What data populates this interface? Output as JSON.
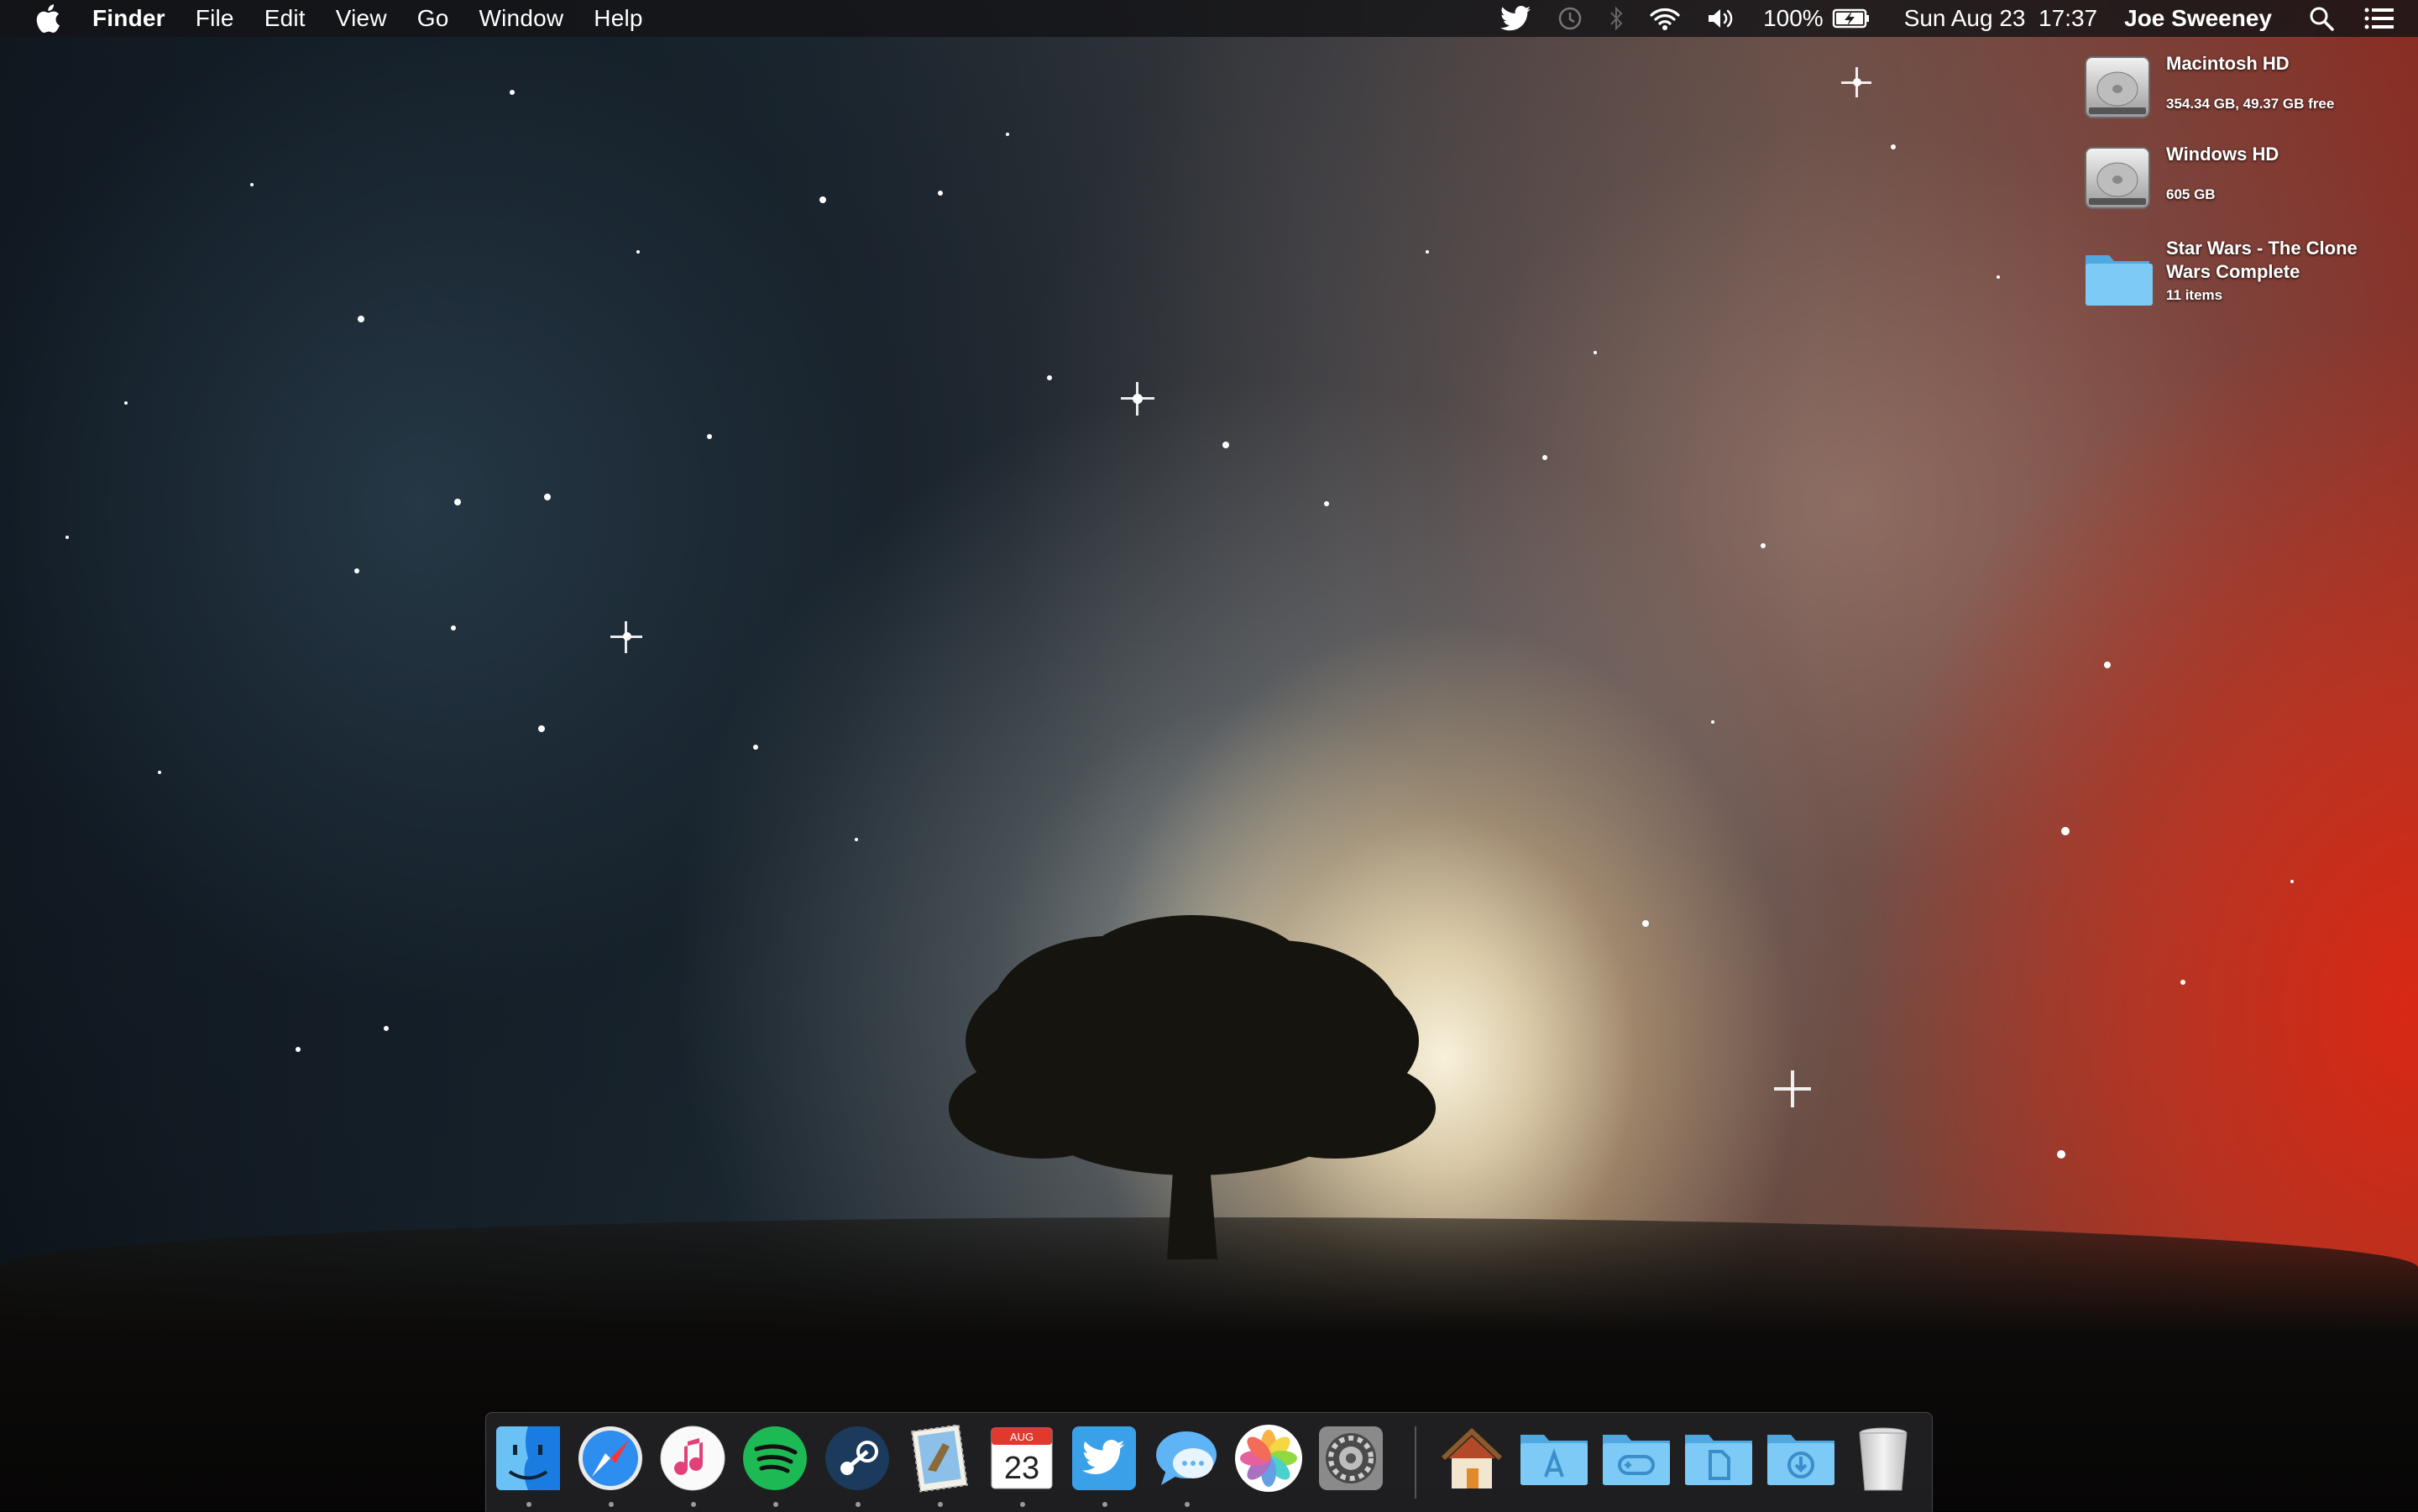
{
  "menubar": {
    "app_name": "Finder",
    "menus": [
      "File",
      "Edit",
      "View",
      "Go",
      "Window",
      "Help"
    ],
    "battery": "100%",
    "datetime": "Sun Aug 23  17:37",
    "user": "Joe Sweeney"
  },
  "desktop_items": [
    {
      "name": "Macintosh HD",
      "detail": "354.34 GB, 49.37 GB free",
      "icon": "hard-drive-icon"
    },
    {
      "name": "Windows HD",
      "detail": "605 GB",
      "icon": "hard-drive-icon"
    },
    {
      "name": "Star Wars - The Clone Wars Complete",
      "detail": "11 items",
      "icon": "folder-icon"
    }
  ],
  "dock": {
    "calendar_month": "AUG",
    "calendar_day": "23",
    "apps": [
      "Finder",
      "Safari",
      "iTunes",
      "Spotify",
      "Steam",
      "Mail",
      "Calendar",
      "Twitter",
      "Messages",
      "Photos",
      "System Preferences"
    ],
    "folders": [
      "Home",
      "Applications",
      "Games",
      "Documents",
      "Downloads",
      "Trash"
    ]
  },
  "colors": {
    "accent_blue": "#3d9be9",
    "spotify_green": "#1db954",
    "folder_blue": "#6ec0f0"
  }
}
